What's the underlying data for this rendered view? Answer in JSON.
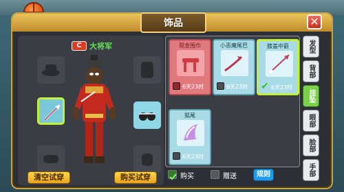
{
  "window": {
    "title": "饰品",
    "close_label": "✕"
  },
  "character": {
    "rank_badge": "C",
    "name": "大将军"
  },
  "buttons": {
    "clear_try_on": "清空试穿",
    "buy_try_on": "购买试穿"
  },
  "items": [
    {
      "name": "现金围巾",
      "time": "6天23时",
      "style": "red",
      "checked": false
    },
    {
      "name": "小恶魔尾巴",
      "time": "6天23时",
      "style": "blue",
      "checked": false
    },
    {
      "name": "膝盖中箭",
      "time": "6天23时",
      "style": "blue",
      "checked": true
    },
    {
      "name": "狐尾",
      "time": "6天23时",
      "style": "blue",
      "checked": false
    }
  ],
  "categories": [
    "发型",
    "背部",
    "挂坠",
    "眼部",
    "脸部",
    "手部"
  ],
  "active_category": "挂坠",
  "bottom_bar": {
    "buy_label": "购买",
    "buy_checked": true,
    "gift_label": "赠送",
    "gift_checked": false,
    "rules_label": "规则"
  },
  "colors": {
    "frame_gold": "#c7a247",
    "selected_outline": "#c3f03b",
    "active_tab": "#7ad14a",
    "button_yellow": "#ffd84a",
    "rules_blue": "#1e9cf0",
    "name_green": "#5fe04f"
  }
}
